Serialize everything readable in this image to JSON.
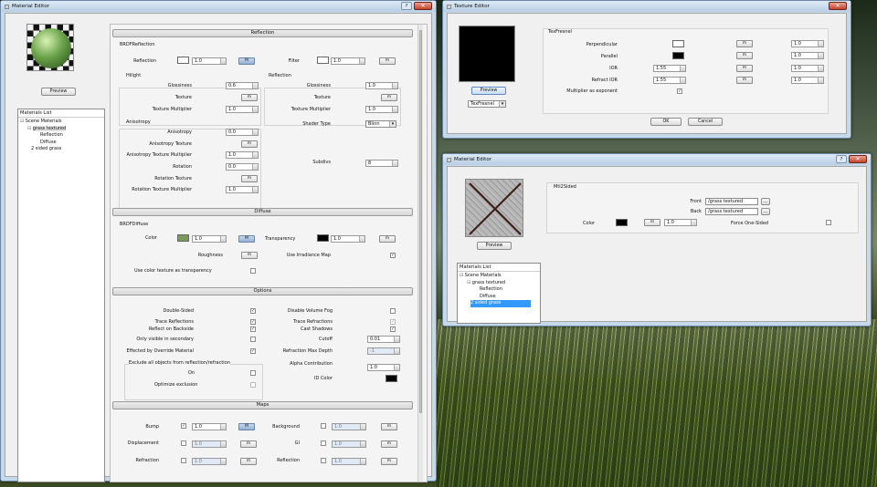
{
  "me1": {
    "title": "Material Editor",
    "preview_button": "Preview",
    "materials_list_header": "Materials List",
    "tree": [
      "Scene Materials",
      "grass textured",
      "Reflection",
      "Diffuse",
      "2 sided grass"
    ],
    "sections": {
      "reflection": "Reflection",
      "diffuse": "Diffuse",
      "options": "Options",
      "maps": "Maps"
    },
    "brdf_reflection": "BRDFReflection",
    "reflection_label": "Reflection",
    "filter_label": "Filter",
    "hilight": "Hilight",
    "reflection_group": "Reflection",
    "glossiness": "Glossiness",
    "texture": "Texture",
    "texture_multiplier": "Texture Multiplier",
    "shader_type": "Shader Type",
    "shader_type_value": "Blinn",
    "anisotropy_group": "Anisotropy",
    "anisotropy": "Anisotropy",
    "anisotropy_texture": "Anisotropy Texture",
    "anisotropy_texture_multiplier": "Anisotropy Texture Multiplier",
    "rotation": "Rotation",
    "rotation_texture": "Rotation Texture",
    "rotation_texture_multiplier": "Rotation Texture Multiplier",
    "subdivs": "Subdivs",
    "brdf_diffuse": "BRDFDiffuse",
    "color": "Color",
    "transparency": "Transparency",
    "roughness": "Roughness",
    "use_irradiance_map": "Use Irradiance Map",
    "use_color_texture": "Use color texture as transparency",
    "double_sided": "Double-Sided",
    "trace_reflections": "Trace Reflections",
    "reflect_on_backside": "Reflect on Backside",
    "only_visible_secondary": "Only visible in secondary",
    "effected_by_override": "Effected by Override Material",
    "exclude_all": "Exclude all objects from reflection/refraction",
    "on": "On",
    "optimize_exclusion": "Optimize exclusion",
    "disable_volume_fog": "Disable Volume Fog",
    "trace_refractions": "Trace Refractions",
    "cast_shadows": "Cast Shadows",
    "cutoff": "Cutoff",
    "refraction_max_depth": "Refraction Max Depth",
    "alpha_contribution": "Alpha Contribution",
    "id_color": "ID Color",
    "bump": "Bump",
    "displacement": "Displacement",
    "refraction": "Refraction",
    "background": "Background",
    "gi": "GI",
    "reflection_map": "Reflection",
    "m_label": "m",
    "M_label": "M",
    "values": {
      "reflection_mult": "1.0",
      "filter_mult": "1.0",
      "glossiness_h": "0.6",
      "tex_mult_h": "1.0",
      "glossiness_r": "1.0",
      "tex_mult_r": "1.0",
      "anisotropy": "0.0",
      "aniso_tex_mult": "1.0",
      "rotation": "0.0",
      "rot_tex_mult": "1.0",
      "subdivs": "8",
      "diffuse_mult": "1.0",
      "transparency_mult": "1.0",
      "cutoff": "0.01",
      "refraction_max_depth": "-1",
      "alpha_contribution": "1.0",
      "bump": "1.0",
      "displacement": "1.0",
      "refraction": "1.0",
      "background": "1.0",
      "gi": "1.0",
      "reflection": "1.0"
    },
    "colors": {
      "reflection": "#ffffff",
      "filter": "#ffffff",
      "diffuse": "#7a9a5a",
      "transparency": "#000000",
      "id": "#000000"
    }
  },
  "te": {
    "title": "Texture Editor",
    "preview_button": "Preview",
    "type_value": "TexFresnel",
    "group": "TexFresnel",
    "perpendicular": "Perpendicular",
    "parallel": "Parallel",
    "ior": "IOR",
    "refract_ior": "Refract IOR",
    "multiplier_as_exponent": "Multiplier as exponent",
    "ok": "OK",
    "cancel": "Cancel",
    "m_label": "m",
    "values": {
      "ior": "1.55",
      "refract_ior": "1.55",
      "perp_mult": "1.0",
      "par_mult": "1.0",
      "ior_mult": "1.0",
      "rior_mult": "1.0"
    },
    "colors": {
      "perpendicular": "#ffffff",
      "parallel": "#000000"
    }
  },
  "me2": {
    "title": "Material Editor",
    "preview_button": "Preview",
    "materials_list_header": "Materials List",
    "tree": [
      "Scene Materials",
      "grass textured",
      "Reflection",
      "Diffuse",
      "2 sided grass"
    ],
    "group": "Mtl2Sided",
    "front": "Front",
    "back": "Back",
    "front_value": "/grass textured",
    "back_value": "/grass textured",
    "color": "Color",
    "color_mult": "1.0",
    "force_one_sided": "Force One-Sided",
    "m_label": "m",
    "browse": "...",
    "colors": {
      "color": "#000000"
    }
  }
}
